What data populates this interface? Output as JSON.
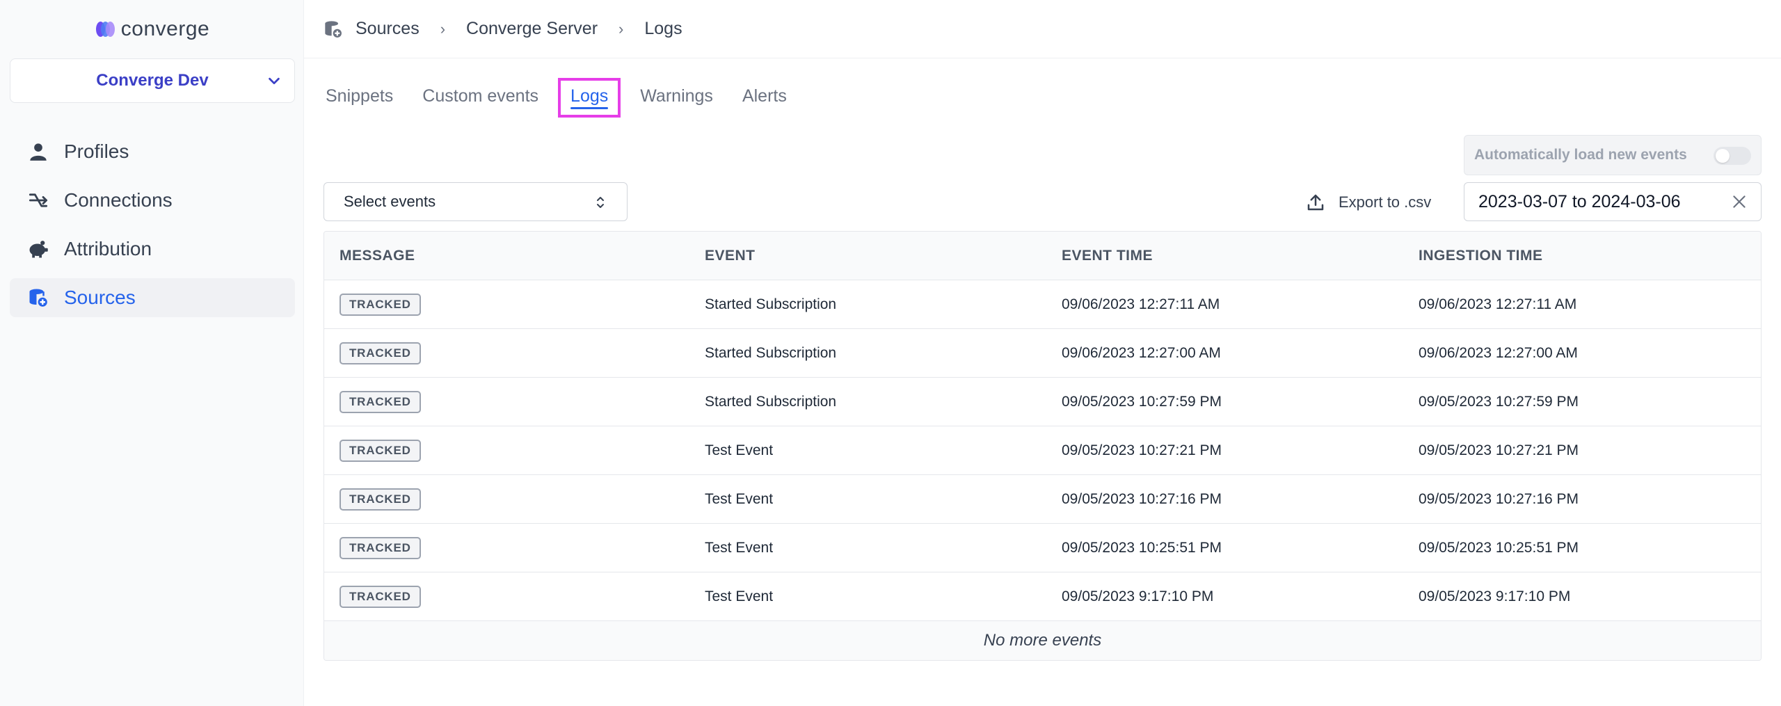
{
  "app": {
    "brand": "converge"
  },
  "workspace": {
    "label": "Converge Dev"
  },
  "sidebar": {
    "items": [
      {
        "label": "Profiles",
        "icon": "person-icon",
        "active": false
      },
      {
        "label": "Connections",
        "icon": "connections-icon",
        "active": false
      },
      {
        "label": "Attribution",
        "icon": "piggy-bank-icon",
        "active": false
      },
      {
        "label": "Sources",
        "icon": "database-add-icon",
        "active": true
      }
    ]
  },
  "breadcrumb": {
    "items": [
      "Sources",
      "Converge Server",
      "Logs"
    ]
  },
  "tabs": [
    {
      "label": "Snippets",
      "active": false
    },
    {
      "label": "Custom events",
      "active": false
    },
    {
      "label": "Logs",
      "active": true
    },
    {
      "label": "Warnings",
      "active": false
    },
    {
      "label": "Alerts",
      "active": false
    }
  ],
  "autoload": {
    "label": "Automatically load new events",
    "enabled": false
  },
  "filters": {
    "select_label": "Select events",
    "export_label": "Export to .csv",
    "date_range": "2023-03-07 to 2024-03-06"
  },
  "table": {
    "columns": [
      "MESSAGE",
      "EVENT",
      "EVENT TIME",
      "INGESTION TIME"
    ],
    "rows": [
      {
        "message": "TRACKED",
        "event": "Started Subscription",
        "event_time": "09/06/2023 12:27:11 AM",
        "ingestion_time": "09/06/2023 12:27:11 AM"
      },
      {
        "message": "TRACKED",
        "event": "Started Subscription",
        "event_time": "09/06/2023 12:27:00 AM",
        "ingestion_time": "09/06/2023 12:27:00 AM"
      },
      {
        "message": "TRACKED",
        "event": "Started Subscription",
        "event_time": "09/05/2023 10:27:59 PM",
        "ingestion_time": "09/05/2023 10:27:59 PM"
      },
      {
        "message": "TRACKED",
        "event": "Test Event",
        "event_time": "09/05/2023 10:27:21 PM",
        "ingestion_time": "09/05/2023 10:27:21 PM"
      },
      {
        "message": "TRACKED",
        "event": "Test Event",
        "event_time": "09/05/2023 10:27:16 PM",
        "ingestion_time": "09/05/2023 10:27:16 PM"
      },
      {
        "message": "TRACKED",
        "event": "Test Event",
        "event_time": "09/05/2023 10:25:51 PM",
        "ingestion_time": "09/05/2023 10:25:51 PM"
      },
      {
        "message": "TRACKED",
        "event": "Test Event",
        "event_time": "09/05/2023 9:17:10 PM",
        "ingestion_time": "09/05/2023 9:17:10 PM"
      }
    ],
    "footer": "No more events"
  },
  "colors": {
    "accent": "#2563eb",
    "brand": "#3b3fc6",
    "highlight": "#e63ee8"
  }
}
